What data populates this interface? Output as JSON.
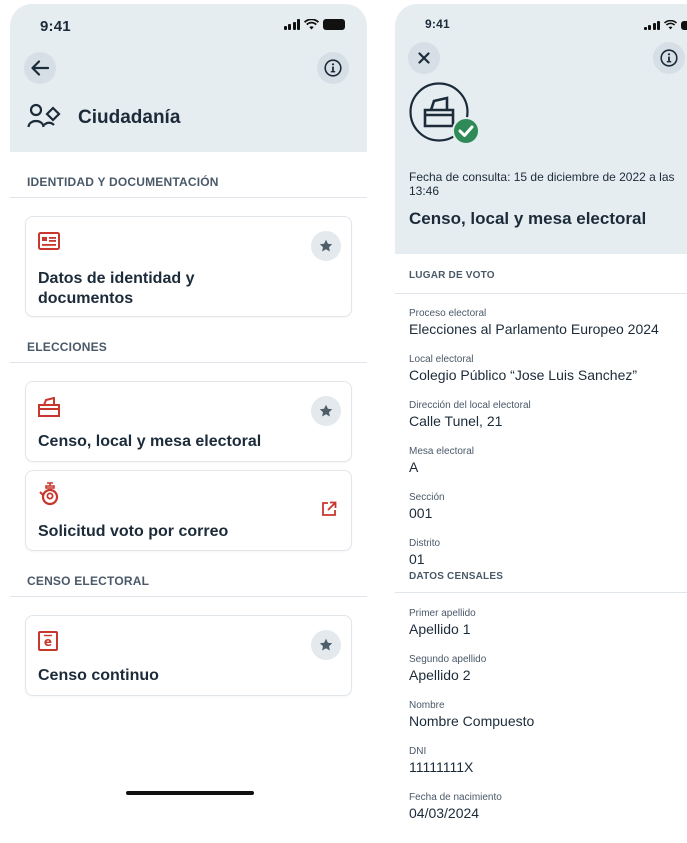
{
  "left": {
    "status": {
      "time": "9:41"
    },
    "page_title": "Ciudadanía",
    "sections": [
      {
        "title": "IDENTIDAD Y DOCUMENTACIÓN"
      },
      {
        "title": "ELECCIONES"
      },
      {
        "title": "CENSO ELECTORAL"
      }
    ],
    "cards": [
      {
        "title": "Datos de identidad y documentos",
        "icon": "id-card-icon",
        "action": "star-icon"
      },
      {
        "title": "Censo, local y mesa electoral",
        "icon": "ballot-box-icon",
        "action": "star-icon"
      },
      {
        "title": "Solicitud voto por correo",
        "icon": "postal-horn-icon",
        "action": "external-link-icon"
      },
      {
        "title": "Censo continuo",
        "icon": "census-doc-icon",
        "action": "star-icon"
      }
    ]
  },
  "right": {
    "status": {
      "time": "9:41"
    },
    "consult_text": "Fecha de consulta: 15 de diciembre de 2022 a las 13:46",
    "title": "Censo, local y mesa electoral",
    "sections": [
      {
        "title": "LUGAR DE VOTO",
        "fields": [
          {
            "label": "Proceso electoral",
            "value": "Elecciones al Parlamento Europeo 2024"
          },
          {
            "label": "Local electoral",
            "value": "Colegio Público “Jose Luis Sanchez”"
          },
          {
            "label": "Dirección del local electoral",
            "value": "Calle Tunel, 21"
          },
          {
            "label": "Mesa electoral",
            "value": "A"
          },
          {
            "label": "Sección",
            "value": "001"
          },
          {
            "label": "Distrito",
            "value": "01"
          }
        ]
      },
      {
        "title": "DATOS CENSALES",
        "fields": [
          {
            "label": "Primer apellido",
            "value": "Apellido 1"
          },
          {
            "label": "Segundo apellido",
            "value": "Apellido 2"
          },
          {
            "label": "Nombre",
            "value": "Nombre Compuesto"
          },
          {
            "label": "DNI",
            "value": "11111111X"
          },
          {
            "label": "Fecha de nacimiento",
            "value": "04/03/2024"
          }
        ]
      }
    ]
  },
  "colors": {
    "accent_red": "#c8372d",
    "header_bg": "#e6edf1",
    "success_green": "#2e8b57",
    "text_dark": "#1c2b39"
  }
}
